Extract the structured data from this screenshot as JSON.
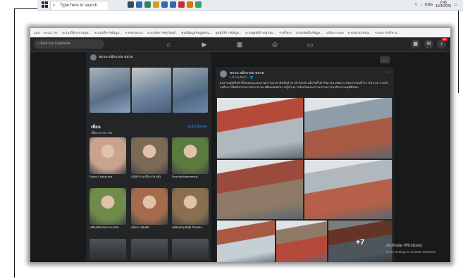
{
  "taskbar": {
    "search_placeholder": "Type here to search",
    "language": "ENG",
    "time": "2:45",
    "date": "10/4/2020",
    "app_colors": [
      "#3c4b57",
      "#2b6cb0",
      "#2f855a",
      "#d4a017",
      "#2b6cb0",
      "#2b6cb0",
      "#c53030",
      "#d97706",
      "#38a169"
    ]
  },
  "browser": {
    "bookmarks": [
      "แอป",
      "NACC TR.",
      "ระบบบริหารงานบุค...",
      "ระบบบริหารข้อมูล...",
      "e-PlanNACC",
      "ระบบจัดการครุภัณฑ์...",
      "ศูนย์ข้อมูลข้อมูลสรุป...",
      "ศูนย์บริการข้อมูล...",
      "ระบบศูนย์ดำรงธรรม...",
      "ราชกิจจา",
      "ระบบจัดเก็บข้อมูล...",
      "Office Home",
      "ระบบสารบรรณ...",
      "ระบบการบริหาร..."
    ]
  },
  "facebook": {
    "search_placeholder": "ค้นหาบน Facebook",
    "notification_count": "99+",
    "group_name": "ชมรม สมัครเล่น ชมรม",
    "menu_label": "...",
    "friends": {
      "title": "เพื่อน",
      "count": "เพื่อน 5,094 คน",
      "see_all": "ดูเพื่อนทั้งหมด",
      "items": [
        {
          "name": "Supha Chaisai and",
          "color": "#c9a38f"
        },
        {
          "name": "สมัยทำงาน ศรีสะเกษ หนึ่ง",
          "color": "#7d6a55"
        },
        {
          "name": "Somchai Manmeesuk",
          "color": "#5b7a3e"
        },
        {
          "name": "เหมือนมิตรสหาย ทะเลชม",
          "color": "#6f8c4a"
        },
        {
          "name": "สุนันทา สุนันทิศ",
          "color": "#a56b4d"
        },
        {
          "name": "สุทธิพงษ์ สุทธิภูมิ ตำแหน่ง",
          "color": "#8a6f4f"
        }
      ]
    },
    "post": {
      "author": "ชมรม สมัครเล่น ชมรม",
      "time": "3 ชั่วโมงที่แล้ว · 🌐",
      "more": "···",
      "text": "ผลงานปฏิบัติหน้าที่ของคณะอนุกรรมการประชาสัมพันธ์ ประจำจังหวัด เมื่อวันที่ 30 กันยายน 2563 ณ ห้องประชุมที่ว่าการอำเภอ ร่วมกับองค์กรภาคีเครือข่ายภาคประชาชน เพื่อเผยแพร่ความรู้ด้านการป้องกันและปราบปรามการทุจริต ประพฤติมิชอบ",
      "more_photos": "+7",
      "photo_colors": [
        "#b64a3a",
        "#8f9da8",
        "#9a4b3b",
        "#b0b8bd",
        "#a85a45",
        "#8e7a66",
        "#b56048",
        "#c6cfd4"
      ]
    },
    "watermark": {
      "title": "Activate Windows",
      "subtitle": "Go to Settings to activate Windows."
    }
  }
}
